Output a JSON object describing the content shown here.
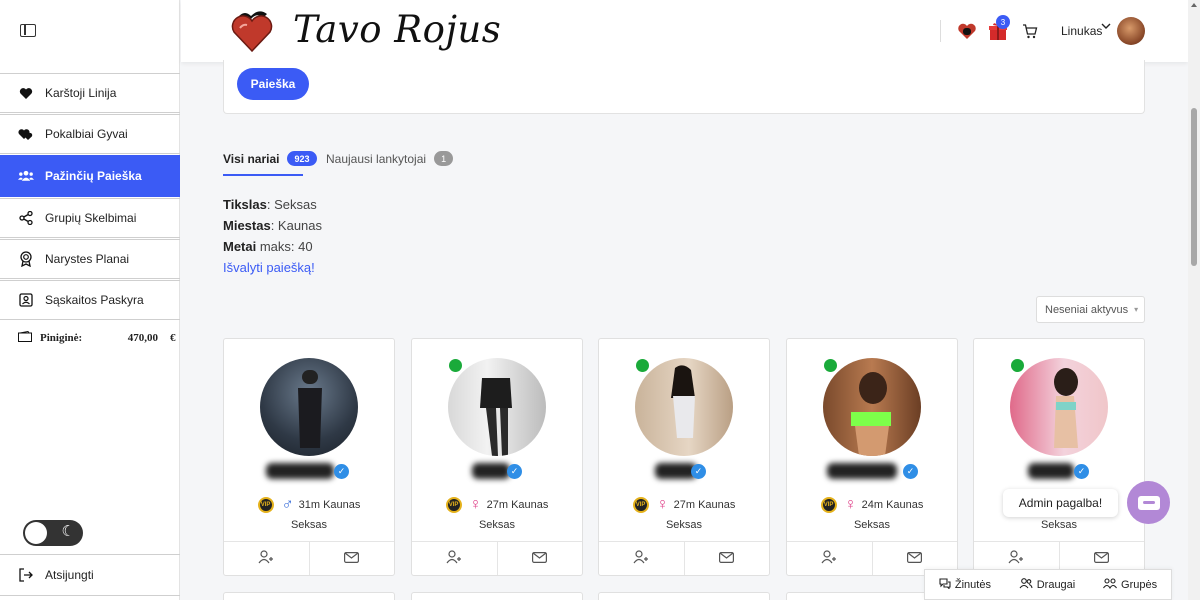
{
  "sidebar": {
    "items": [
      {
        "label": "Karštoji Linija",
        "icon": "heart-icon"
      },
      {
        "label": "Pokalbiai Gyvai",
        "icon": "hearts-icon"
      },
      {
        "label": "Pažinčių Paieška",
        "icon": "users-icon",
        "active": true
      },
      {
        "label": "Grupių Skelbimai",
        "icon": "share-icon"
      },
      {
        "label": "Narystes Planai",
        "icon": "award-icon"
      },
      {
        "label": "Sąskaitos Paskyra",
        "icon": "account-icon"
      }
    ],
    "wallet": {
      "label": "Piniginė:",
      "amount": "470,00",
      "currency": "€"
    },
    "logout_label": "Atsijungti"
  },
  "header": {
    "logo_text": "Tavo Rojus",
    "gift_badge": "3",
    "username": "Linukas"
  },
  "search": {
    "button_label": "Paieška"
  },
  "tabs": [
    {
      "label": "Visi nariai",
      "count": "923",
      "active": true
    },
    {
      "label": "Naujausi lankytojai",
      "count": "1"
    }
  ],
  "filters": {
    "goal_label": "Tikslas",
    "goal_value": ": Seksas",
    "city_label": "Miestas",
    "city_value": ": Kaunas",
    "age_label": "Metai",
    "age_value": " maks: 40",
    "clear_label": "Išvalyti paiešką!"
  },
  "sort": {
    "selected": "Neseniai aktyvus"
  },
  "members": [
    {
      "info": "31m Kaunas",
      "goal": "Seksas",
      "gender": "male",
      "online": false,
      "vip": true
    },
    {
      "info": "27m Kaunas",
      "goal": "Seksas",
      "gender": "female",
      "online": true,
      "vip": true
    },
    {
      "info": "27m Kaunas",
      "goal": "Seksas",
      "gender": "female",
      "online": true,
      "vip": true
    },
    {
      "info": "24m Kaunas",
      "goal": "Seksas",
      "gender": "female",
      "online": true,
      "vip": true
    },
    {
      "info": "",
      "goal": "Seksas",
      "gender": "female",
      "online": true,
      "vip": false
    }
  ],
  "chat": {
    "bubble_label": "Admin pagalba!"
  },
  "bottom_bar": {
    "messages": "Žinutės",
    "friends": "Draugai",
    "groups": "Grupės"
  },
  "colors": {
    "accent": "#3b5bf5",
    "online": "#1aaa3a",
    "verified": "#2f8ee6",
    "chat": "#b288d6"
  }
}
